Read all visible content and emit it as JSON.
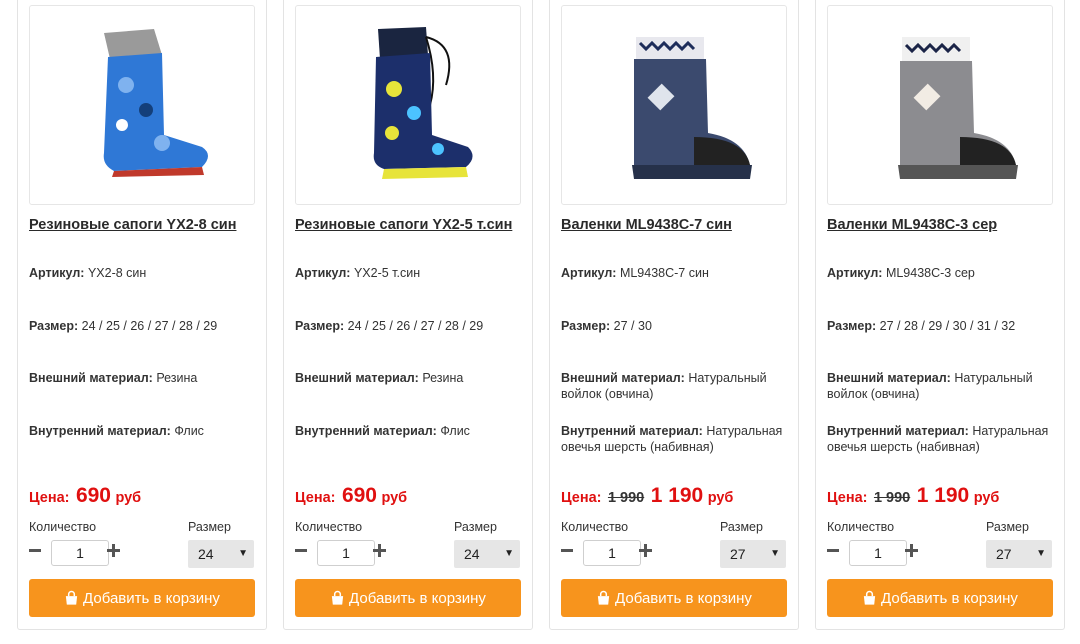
{
  "labels": {
    "article": "Артикул:",
    "size": "Размер:",
    "outer": "Внешний материал:",
    "inner": "Внутренний материал:",
    "price": "Цена:",
    "currency": "руб",
    "quantity": "Количество",
    "size_select": "Размер",
    "add_to_cart": "Добавить в корзину"
  },
  "colors": {
    "accent": "#f7941d",
    "price": "#e01010"
  },
  "products": [
    {
      "title": "Резиновые сапоги YX2-8 син",
      "sku": "YX2-8 син",
      "sizes": "24 / 25 / 26 / 27 / 28 / 29",
      "outer": "Резина",
      "inner": "Флис",
      "old_price": "",
      "price": "690",
      "qty": "1",
      "size_selected": "24",
      "icon": "rubber-boot-blue-image"
    },
    {
      "title": "Резиновые сапоги YX2-5 т.син",
      "sku": "YX2-5 т.син",
      "sizes": "24 / 25 / 26 / 27 / 28 / 29",
      "outer": "Резина",
      "inner": "Флис",
      "old_price": "",
      "price": "690",
      "qty": "1",
      "size_selected": "24",
      "icon": "rubber-boot-navy-image"
    },
    {
      "title": "Валенки ML9438C-7 син",
      "sku": "ML9438C-7 син",
      "sizes": "27 / 30",
      "outer": "Натуральный войлок (овчина)",
      "inner": "Натуральная овечья шерсть (набивная)",
      "old_price": "1 990",
      "price": "1 190",
      "qty": "1",
      "size_selected": "27",
      "icon": "felt-boot-blue-image"
    },
    {
      "title": "Валенки ML9438C-3 сер",
      "sku": "ML9438C-3 сер",
      "sizes": "27 / 28 / 29 / 30 / 31 / 32",
      "outer": "Натуральный войлок (овчина)",
      "inner": "Натуральная овечья шерсть (набивная)",
      "old_price": "1 990",
      "price": "1 190",
      "qty": "1",
      "size_selected": "27",
      "icon": "felt-boot-grey-image"
    }
  ]
}
